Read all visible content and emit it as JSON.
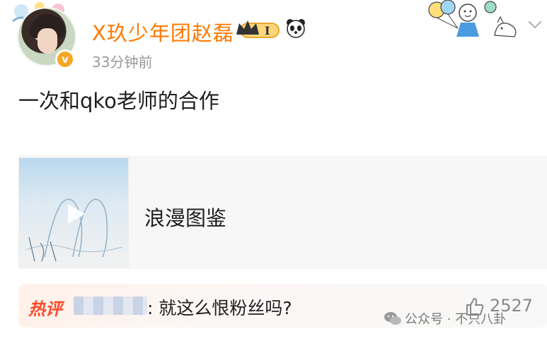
{
  "author": {
    "name": "X玖少年团赵磊",
    "time": "33分钟前",
    "verified_mark": "v",
    "member_level": "I"
  },
  "post": {
    "text": "一次和qko老师的合作"
  },
  "video": {
    "title": "浪漫图鉴"
  },
  "hot_comment": {
    "label": "热评",
    "text": ": 就这么恨粉丝吗?",
    "likes": "2527"
  },
  "watermark": {
    "text": "公众号 · 不只八卦"
  },
  "colors": {
    "username": "#ff7a00",
    "hot_label": "#ff4b2b",
    "badge": "#f6a623"
  },
  "icons": [
    "panda-icon",
    "chevron-down-icon",
    "play-icon",
    "thumbs-up-icon",
    "wechat-icon",
    "crown-icon"
  ]
}
